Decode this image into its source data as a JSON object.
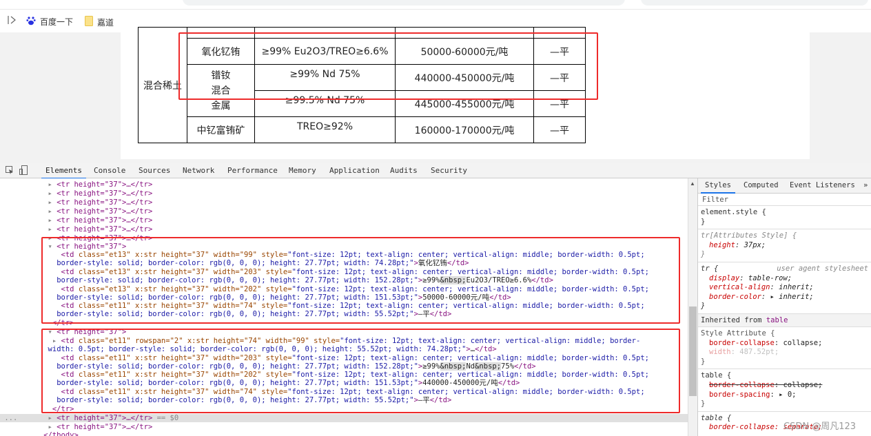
{
  "bookmarks": [
    {
      "icon": "baidu-paw-icon",
      "label": "百度一下"
    },
    {
      "icon": "folder-icon",
      "label": "嘉道"
    }
  ],
  "table": {
    "group_label": "混合稀土",
    "rows": [
      {
        "name": "",
        "spec": "",
        "price": "",
        "trend": ""
      },
      {
        "name": "氧化钇铕",
        "spec": "≥99% Eu2O3/TREO≥6.6%",
        "price": "50000-60000元/吨",
        "trend": "—平"
      },
      {
        "name_line1": "镨钕",
        "name_line2": "混合",
        "name_line3": "金属",
        "spec": "≥99% Nd 75%",
        "price": "440000-450000元/吨",
        "trend": "—平"
      },
      {
        "spec": "≥99.5% Nd 75%",
        "price": "445000-455000元/吨",
        "trend": "—平"
      },
      {
        "name": "中钇富铕矿",
        "spec": "TREO≥92%",
        "price": "160000-170000元/吨",
        "trend": "—平"
      }
    ]
  },
  "devtools": {
    "tabs": [
      "Elements",
      "Console",
      "Sources",
      "Network",
      "Performance",
      "Memory",
      "Application",
      "Audits",
      "Security"
    ],
    "active_tab": "Elements",
    "collapsed_row": "<tr height=\"37\">…</tr>",
    "expanded_row_open": "<tr height=\"37\">",
    "row_close": "</tr>",
    "selected_suffix": " == $0",
    "tbody_close": "</tbody>",
    "row1_cells": [
      {
        "attrs": "class=\"et13\" x:str height=\"37\" width=\"99\"",
        "style_a": "font-size: 12pt; text-align: center; vertical-align: middle; border-width: 0.5pt;",
        "style_b": "border-style: solid; border-color: rgb(0, 0, 0); height: 27.77pt; width: 74.28pt;",
        "content": "氧化钇铕"
      },
      {
        "attrs": "class=\"et13\" x:str height=\"37\" width=\"203\"",
        "style_a": "font-size: 12pt; text-align: center; vertical-align: middle; border-width: 0.5pt;",
        "style_b": "border-style: solid; border-color: rgb(0, 0, 0); height: 27.77pt; width: 152.28pt;",
        "content_pre": "≥99%",
        "content_nbsp": "&nbsp;",
        "content_post": "Eu2O3/TREO≥6.6%"
      },
      {
        "attrs": "class=\"et13\" x:str height=\"37\" width=\"202\"",
        "style_a": "font-size: 12pt; text-align: center; vertical-align: middle; border-width: 0.5pt;",
        "style_b": "border-style: solid; border-color: rgb(0, 0, 0); height: 27.77pt; width: 151.53pt;",
        "content": "50000-60000元/吨"
      },
      {
        "attrs": "class=\"et11\" x:str height=\"37\" width=\"74\"",
        "style_a": "font-size: 12pt; text-align: center; vertical-align: middle; border-width: 0.5pt;",
        "style_b": "border-style: solid; border-color: rgb(0, 0, 0); height: 27.77pt; width: 55.52pt;",
        "content": "—平"
      }
    ],
    "row2_cells": [
      {
        "attrs": "class=\"et11\" rowspan=\"2\" x:str height=\"74\" width=\"99\"",
        "style_a": "font-size: 12pt; text-align: center; vertical-align: middle; border-",
        "style_b": "width: 0.5pt; border-style: solid; border-color: rgb(0, 0, 0); height: 55.52pt; width: 74.28pt;",
        "content": "…"
      },
      {
        "attrs": "class=\"et11\" x:str height=\"37\" width=\"203\"",
        "style_a": "font-size: 12pt; text-align: center; vertical-align: middle; border-width: 0.5pt;",
        "style_b": "border-style: solid; border-color: rgb(0, 0, 0); height: 27.77pt; width: 152.28pt;",
        "content_pre": "≥99%",
        "content_nbsp": "&nbsp;",
        "content_mid": "Nd",
        "content_nbsp2": "&nbsp;",
        "content_post": "75%"
      },
      {
        "attrs": "class=\"et11\" x:str height=\"37\" width=\"202\"",
        "style_a": "font-size: 12pt; text-align: center; vertical-align: middle; border-width: 0.5pt;",
        "style_b": "border-style: solid; border-color: rgb(0, 0, 0); height: 27.77pt; width: 151.53pt;",
        "content": "440000-450000元/吨"
      },
      {
        "attrs": "class=\"et11\" x:str height=\"37\" width=\"74\"",
        "style_a": "font-size: 12pt; text-align: center; vertical-align: middle; border-width: 0.5pt;",
        "style_b": "border-style: solid; border-color: rgb(0, 0, 0); height: 27.77pt; width: 55.52pt;",
        "content": "—平"
      }
    ]
  },
  "styles_pane": {
    "tabs": [
      "Styles",
      "Computed",
      "Event Listeners",
      "»"
    ],
    "filter_placeholder": "Filter",
    "element_style": "element.style {",
    "close_brace": "}",
    "attr_rule_selector": "tr[Attributes Style] {",
    "attr_rule_prop": "height",
    "attr_rule_val": "37px;",
    "tr_selector": "tr {",
    "tr_origin": "user agent stylesheet",
    "tr_props": [
      {
        "prop": "display",
        "val": "table-row;"
      },
      {
        "prop": "vertical-align",
        "val": "inherit;"
      },
      {
        "prop": "border-color",
        "val": "▸ inherit;"
      }
    ],
    "inherited_label": "Inherited from",
    "inherited_from": "table",
    "style_attr_selector": "Style Attribute {",
    "style_attr_props": [
      {
        "prop": "border-collapse",
        "val": "collapse;"
      },
      {
        "prop": "width",
        "val": "487.52pt;"
      }
    ],
    "table_selector": "table {",
    "table_props": [
      {
        "prop": "border-collapse",
        "val": "collapse;"
      },
      {
        "prop": "border-spacing",
        "val": "▸ 0;"
      }
    ],
    "table2_selector": "table {",
    "table2_prop_partial": "border-collapse: separate;"
  },
  "watermark": "CSDN @周凡123"
}
